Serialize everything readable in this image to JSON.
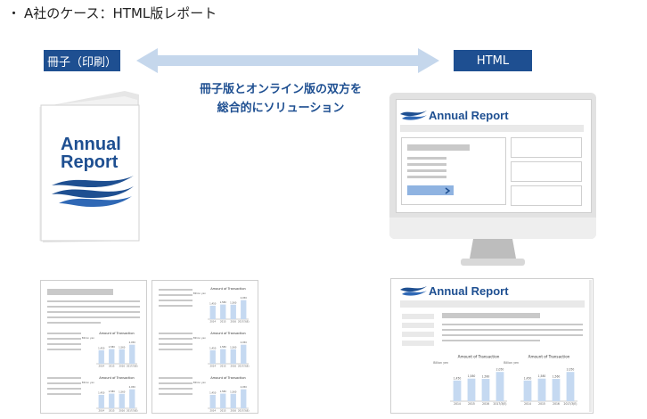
{
  "header": {
    "bullet": "・",
    "title": "A社のケース：HTML版レポート"
  },
  "labels": {
    "print": "冊子（印刷）",
    "html": "HTML"
  },
  "caption": {
    "line1": "冊子版とオンライン版の双方を",
    "line2": "総合的にソリューション"
  },
  "booklet": {
    "line1": "Annual",
    "line2": "Report"
  },
  "monitor": {
    "title": "Annual Report"
  },
  "webpage": {
    "title": "Annual Report"
  },
  "chart_data": [
    {
      "type": "bar",
      "title": "Amount of Transaction",
      "categories": [
        "2014",
        "2015",
        "2016",
        "2017/3(E)"
      ],
      "values": [
        1450,
        1580,
        1560,
        2050
      ],
      "ylabel": "Billion yen",
      "ylim": [
        0,
        2500
      ]
    },
    {
      "type": "bar",
      "title": "Amount of Transaction",
      "categories": [
        "2014",
        "2015",
        "2016",
        "2017/3(E)"
      ],
      "values": [
        1450,
        1580,
        1560,
        2050
      ],
      "ylabel": "Billion yen",
      "ylim": [
        0,
        2500
      ]
    }
  ],
  "colors": {
    "brand_blue": "#1e4f91",
    "bar_blue": "#c5d9f1",
    "arrow_blue": "#c5d7ec"
  }
}
